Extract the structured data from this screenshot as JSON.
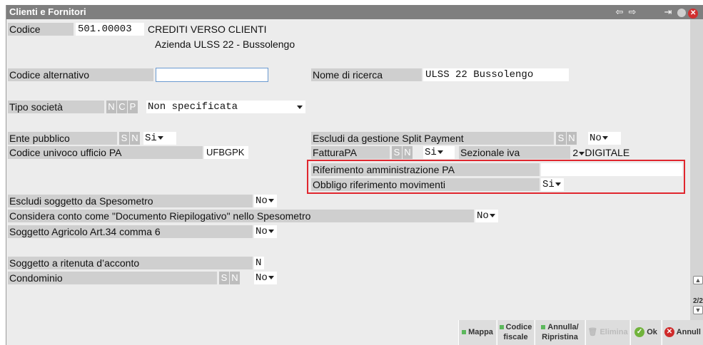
{
  "window": {
    "title": "Clienti e Fornitori",
    "page_indicator": "2/2"
  },
  "header": {
    "codice_label": "Codice",
    "codice_value": "501.00003",
    "codice_desc": "CREDITI VERSO CLIENTI",
    "subtitle": "Azienda ULSS 22 - Bussolengo"
  },
  "fields": {
    "codice_alternativo": {
      "label": "Codice alternativo",
      "value": ""
    },
    "nome_ricerca": {
      "label": "Nome di ricerca",
      "value": "ULSS 22 Bussolengo"
    },
    "tipo_societa": {
      "label": "Tipo società",
      "flags": [
        "N",
        "C",
        "P"
      ],
      "value": "Non specificata"
    },
    "ente_pubblico": {
      "label": "Ente pubblico",
      "flags": [
        "S",
        "N"
      ],
      "value": "Si"
    },
    "codice_univoco": {
      "label": "Codice univoco ufficio PA",
      "value": "UFBGPK"
    },
    "escludi_split": {
      "label": "Escludi da gestione Split Payment",
      "flags": [
        "S",
        "N"
      ],
      "value": "No"
    },
    "fattura_pa": {
      "label": "FatturaPA",
      "flags": [
        "S",
        "N"
      ],
      "value": "Si"
    },
    "sezionale_iva": {
      "label": "Sezionale iva",
      "value": "2",
      "desc": "DIGITALE"
    },
    "riferimento_amm": {
      "label": "Riferimento amministrazione PA",
      "value": ""
    },
    "obbligo_rif": {
      "label": "Obbligo riferimento movimenti",
      "value": "Si"
    },
    "escludi_spesometro": {
      "label": "Escludi soggetto da Spesometro",
      "value": "No"
    },
    "documento_riepilogativo": {
      "label": "Considera conto come \"Documento Riepilogativo\" nello Spesometro",
      "value": "No"
    },
    "agricolo": {
      "label": "Soggetto Agricolo Art.34 comma 6",
      "value": "No"
    },
    "ritenuta": {
      "label": "Soggetto a ritenuta d’acconto",
      "value": "N"
    },
    "condominio": {
      "label": "Condominio",
      "flags": [
        "S",
        "N"
      ],
      "value": "No"
    }
  },
  "buttons": {
    "mappa": "Mappa",
    "codice_fiscale_1": "Codice",
    "codice_fiscale_2": "fiscale",
    "annulla_ripristina_1": "Annulla/",
    "annulla_ripristina_2": "Ripristina",
    "elimina": "Elimina",
    "ok": "Ok",
    "annulla": "Annull"
  },
  "colors": {
    "titlebar": "#7f7f7f",
    "label_bg": "#cfcfcf",
    "highlight_border": "#e0262e",
    "ok_green": "#71b33c",
    "cancel_red": "#cf2b2b"
  }
}
